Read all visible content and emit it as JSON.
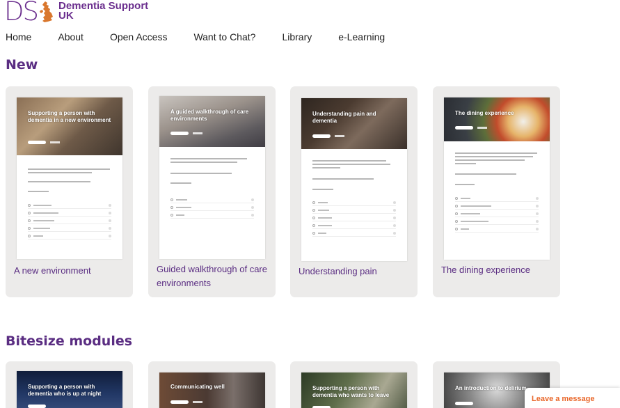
{
  "brand": {
    "initials": "DS",
    "name": "Dementia Support UK",
    "name_line1": "Dementia Support",
    "name_line2": "UK",
    "colors": {
      "purple": "#6b2f8e",
      "map_orange": "#d9772d",
      "card_bg": "#ecebea",
      "chat_orange": "#e9672a"
    }
  },
  "nav": {
    "items": [
      {
        "label": "Home"
      },
      {
        "label": "About"
      },
      {
        "label": "Open Access"
      },
      {
        "label": "Want to Chat?"
      },
      {
        "label": "Library"
      },
      {
        "label": "e-Learning"
      }
    ]
  },
  "sections": {
    "new": {
      "title": "New",
      "cards": [
        {
          "label": "A new environment",
          "hero_title": "Supporting a person with dementia in a new environment",
          "hero_icon": "kitchen-photo"
        },
        {
          "label": "Guided walkthrough of care environments",
          "hero_title": "A guided walkthrough of care environments",
          "hero_icon": "lounge-photo"
        },
        {
          "label": "Understanding pain",
          "hero_title": "Understanding pain and dementia",
          "hero_icon": "hands-photo"
        },
        {
          "label": "The dining experience",
          "hero_title": "The dining experience",
          "hero_icon": "meal-photo"
        }
      ]
    },
    "bitesize": {
      "title": "Bitesize modules",
      "cards": [
        {
          "hero_title": "Supporting a person with dementia who is up at night",
          "hero_icon": "night-sky-photo"
        },
        {
          "hero_title": "Communicating well",
          "hero_icon": "people-talking-photo"
        },
        {
          "hero_title": "Supporting a person with dementia who wants to leave",
          "hero_icon": "outdoors-photo"
        },
        {
          "hero_title": "An introduction to delirium",
          "hero_icon": "bare-tree-photo"
        }
      ]
    }
  },
  "chat": {
    "label": "Leave a message"
  }
}
